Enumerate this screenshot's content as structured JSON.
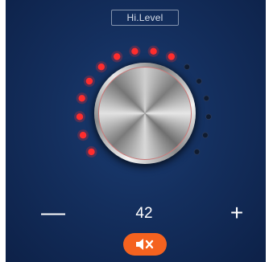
{
  "header": {
    "level_label": "Hi.Level"
  },
  "dial": {
    "icon": "volume-knob",
    "indicator_active_color": "#ff2d2d",
    "indicator_inactive_color": "#0f1b30",
    "indicator_count": 16,
    "active_indicators": 10
  },
  "controls": {
    "decrease_label": "—",
    "increase_label": "+",
    "value": "42"
  },
  "mute": {
    "icon": "speaker-mute-icon",
    "color": "#f4621f"
  }
}
